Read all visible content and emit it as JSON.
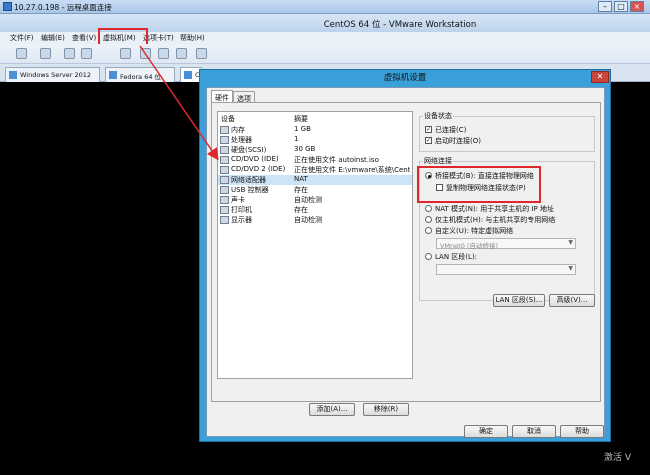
{
  "rdp": {
    "title": "10.27.0.198 - 远程桌面连接"
  },
  "vmware": {
    "title": "CentOS 64 位 - VMware Workstation",
    "menu": [
      "文件(F)",
      "编辑(E)",
      "查看(V)",
      "虚拟机(M)",
      "选项卡(T)",
      "帮助(H)"
    ],
    "tabs": [
      "Windows Server 2012",
      "Fedora 64 位",
      "Ce"
    ]
  },
  "dialog": {
    "title": "虚拟机设置",
    "tabs": [
      "硬件",
      "选项"
    ],
    "list_headers": {
      "device": "设备",
      "summary": "摘要"
    },
    "devices": [
      {
        "name": "内存",
        "summary": "1 GB",
        "icon": "memory-icon"
      },
      {
        "name": "处理器",
        "summary": "1",
        "icon": "cpu-icon"
      },
      {
        "name": "硬盘(SCSI)",
        "summary": "30 GB",
        "icon": "disk-icon"
      },
      {
        "name": "CD/DVD (IDE)",
        "summary": "正在使用文件 autoinst.iso",
        "icon": "cd-icon"
      },
      {
        "name": "CD/DVD 2 (IDE)",
        "summary": "正在使用文件 E:\\vmware\\系统\\CentO...",
        "icon": "cd-icon"
      },
      {
        "name": "网络适配器",
        "summary": "NAT",
        "icon": "network-icon"
      },
      {
        "name": "USB 控制器",
        "summary": "存在",
        "icon": "usb-icon"
      },
      {
        "name": "声卡",
        "summary": "自动检测",
        "icon": "sound-icon"
      },
      {
        "name": "打印机",
        "summary": "存在",
        "icon": "printer-icon"
      },
      {
        "name": "显示器",
        "summary": "自动检测",
        "icon": "monitor-icon"
      }
    ],
    "add_button": "添加(A)...",
    "remove_button": "移除(R)",
    "device_status": {
      "label": "设备状态",
      "connected": "已连接(C)",
      "connect_at_power_on": "启动时连接(O)"
    },
    "network": {
      "label": "网络连接",
      "bridged": "桥接模式(B): 直接连接物理网络",
      "replicate": "复制物理网络连接状态(P)",
      "nat": "NAT 模式(N): 用于共享主机的 IP 地址",
      "host_only": "仅主机模式(H): 与主机共享的专用网络",
      "custom": "自定义(U): 特定虚拟网络",
      "custom_value": "VMnet0 (自动桥接)",
      "lan": "LAN 区段(L):",
      "lan_segments_button": "LAN 区段(S)...",
      "advanced_button": "高级(V)..."
    },
    "ok_button": "确定",
    "cancel_button": "取消",
    "help_button": "帮助"
  },
  "watermark": "激活 V",
  "colors": {
    "highlight": "#e0282c",
    "dialog_frame": "#3b9fd9"
  }
}
